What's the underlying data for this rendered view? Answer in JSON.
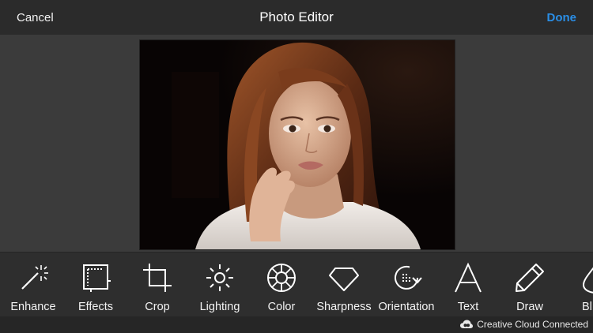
{
  "header": {
    "cancel_label": "Cancel",
    "title": "Photo Editor",
    "done_label": "Done"
  },
  "photo": {
    "subject": "portrait photo of a woman with long auburn hair against a dark background"
  },
  "toolbar": {
    "tools": [
      {
        "label": "Enhance",
        "icon": "magic-wand-icon"
      },
      {
        "label": "Effects",
        "icon": "film-frame-icon"
      },
      {
        "label": "Crop",
        "icon": "crop-icon"
      },
      {
        "label": "Lighting",
        "icon": "sun-icon"
      },
      {
        "label": "Color",
        "icon": "color-wheel-icon"
      },
      {
        "label": "Sharpness",
        "icon": "diamond-icon"
      },
      {
        "label": "Orientation",
        "icon": "rotate-icon"
      },
      {
        "label": "Text",
        "icon": "text-icon"
      },
      {
        "label": "Draw",
        "icon": "pencil-icon"
      },
      {
        "label": "Bl",
        "icon": "drop-icon"
      }
    ]
  },
  "status": {
    "cc_label": "Creative Cloud Connected",
    "cc_icon": "creative-cloud-icon"
  },
  "colors": {
    "accent": "#2a8ee6",
    "toolbar_bg": "#2e2e2e",
    "header_bg": "#2b2b2b"
  }
}
